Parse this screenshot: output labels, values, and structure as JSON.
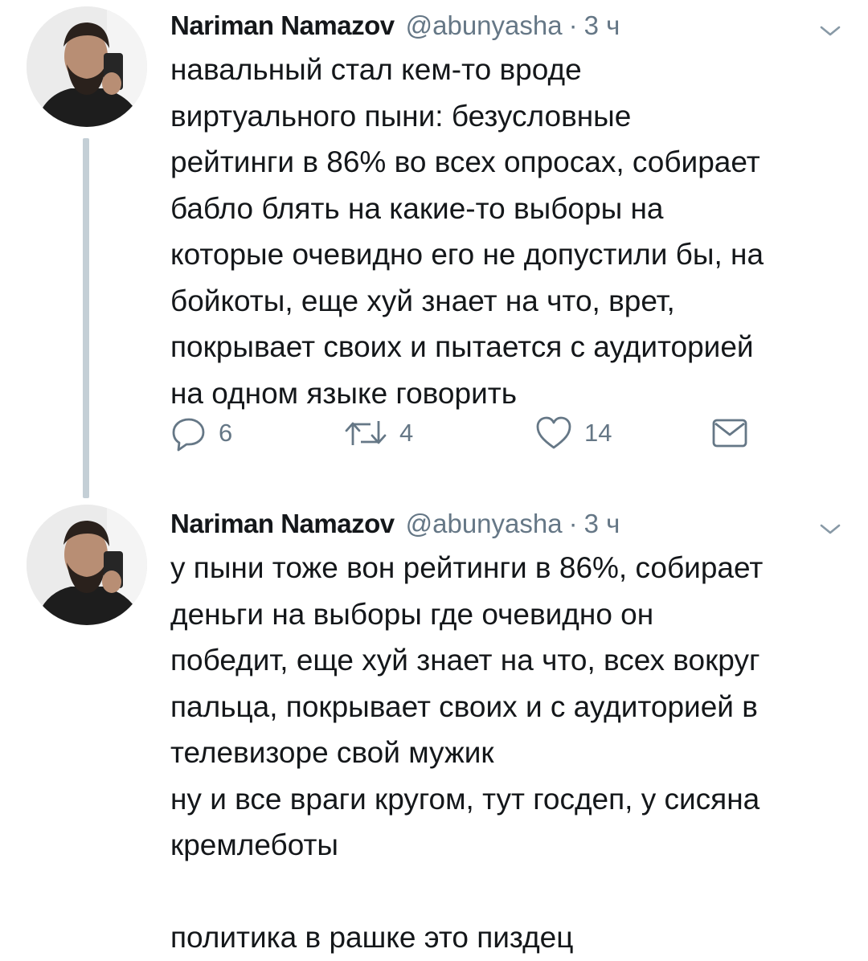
{
  "tweets": [
    {
      "author_name": "Nariman Namazov",
      "handle": "@abunyasha",
      "separator": "·",
      "time": "3 ч",
      "text_lines": [
        "навальный стал кем-то вроде",
        "виртуального пыни: безусловные",
        "рейтинги в 86% во всех опросах, собирает",
        "бабло блять на какие-то выборы на",
        "которые очевидно его не допустили бы, на",
        "бойкоты, еще хуй знает на что, врет,",
        "покрывает своих и пытается с аудиторией",
        "на одном языке говорить"
      ],
      "replies": "6",
      "retweets": "4",
      "likes": "14"
    },
    {
      "author_name": "Nariman Namazov",
      "handle": "@abunyasha",
      "separator": "·",
      "time": "3 ч",
      "text_lines": [
        "у пыни тоже вон рейтинги в 86%, собирает",
        "деньги на выборы где очевидно он",
        "победит, еще хуй знает на что, всех вокруг",
        "пальца, покрывает своих и с аудиторией в",
        "телевизоре свой мужик",
        "ну и все враги кругом, тут госдеп, у сисяна",
        "кремлеботы",
        "",
        "политика в рашке это пиздец"
      ]
    }
  ],
  "icons": {
    "reply": "reply-icon",
    "retweet": "retweet-icon",
    "like": "heart-icon",
    "dm": "envelope-icon",
    "menu": "chevron-down-icon"
  },
  "colors": {
    "text": "#14171a",
    "secondary": "#657786",
    "thread_line": "#c4cfd6"
  }
}
